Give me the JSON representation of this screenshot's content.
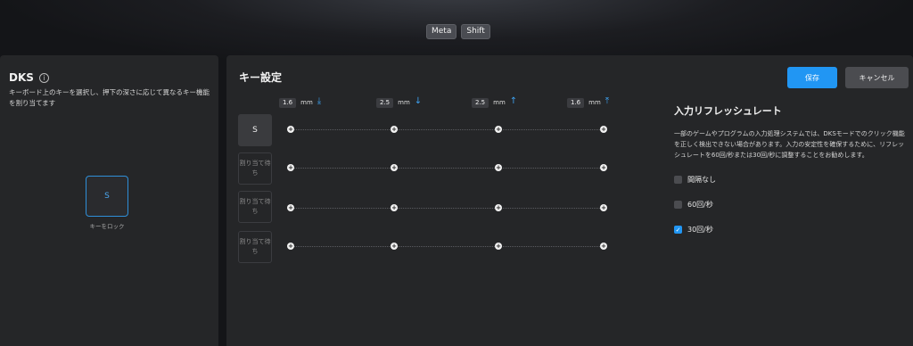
{
  "modifiers": [
    "Meta",
    "Shift"
  ],
  "dks": {
    "title": "DKS",
    "info_icon": "i",
    "description": "キーボード上のキーを選択し、押下の深さに応じて異なるキー機能を割り当てます",
    "lock_key_label": "S",
    "lock_caption": "キーをロック"
  },
  "key_setting": {
    "title": "キー設定",
    "save_label": "保存",
    "cancel_label": "キャンセル",
    "unit": "mm",
    "depths": [
      {
        "value": "1.6",
        "direction": "down"
      },
      {
        "value": "2.5",
        "direction": "down"
      },
      {
        "value": "2.5",
        "direction": "up"
      },
      {
        "value": "1.6",
        "direction": "up"
      }
    ],
    "slots": [
      {
        "label": "S",
        "assigned": true
      },
      {
        "label": "割り当て待ち",
        "assigned": false
      },
      {
        "label": "割り当て待ち",
        "assigned": false
      },
      {
        "label": "割り当て待ち",
        "assigned": false
      }
    ],
    "node_symbol": "+"
  },
  "refresh": {
    "title": "入力リフレッシュレート",
    "description": "一部のゲームやプログラムの入力処理システムでは、DKSモードでのクリック機能を正しく検出できない場合があります。入力の安定性を確保するために、リフレッシュレートを60回/秒または30回/秒に調整することをお勧めします。",
    "options": [
      {
        "label": "間隔なし",
        "checked": false
      },
      {
        "label": "60回/秒",
        "checked": false
      },
      {
        "label": "30回/秒",
        "checked": true
      }
    ],
    "check_mark": "✓"
  },
  "colors": {
    "accent": "#2196f3",
    "panel": "#252628",
    "background": "#141518"
  }
}
